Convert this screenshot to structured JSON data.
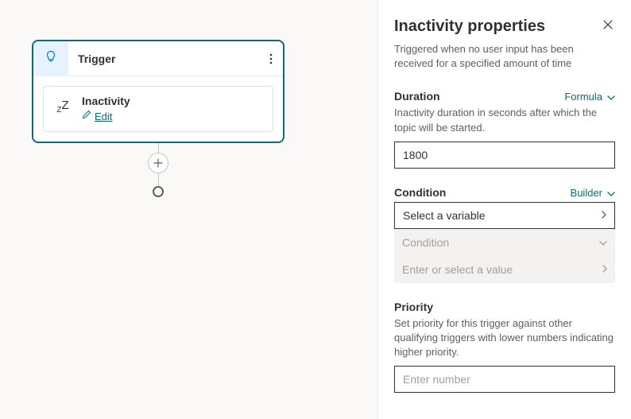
{
  "canvas": {
    "trigger_label": "Trigger",
    "activity_title": "Inactivity",
    "edit_label": "Edit"
  },
  "panel": {
    "title": "Inactivity properties",
    "subtitle": "Triggered when no user input has been received for a specified amount of time",
    "duration": {
      "label": "Duration",
      "mode": "Formula",
      "desc": "Inactivity duration in seconds after which the topic will be started.",
      "value": "1800"
    },
    "condition": {
      "label": "Condition",
      "mode": "Builder",
      "select_placeholder": "Select a variable",
      "cond_placeholder": "Condition",
      "value_placeholder": "Enter or select a value"
    },
    "priority": {
      "label": "Priority",
      "desc": "Set priority for this trigger against other qualifying triggers with lower numbers indicating higher priority.",
      "placeholder": "Enter number",
      "value": ""
    }
  }
}
